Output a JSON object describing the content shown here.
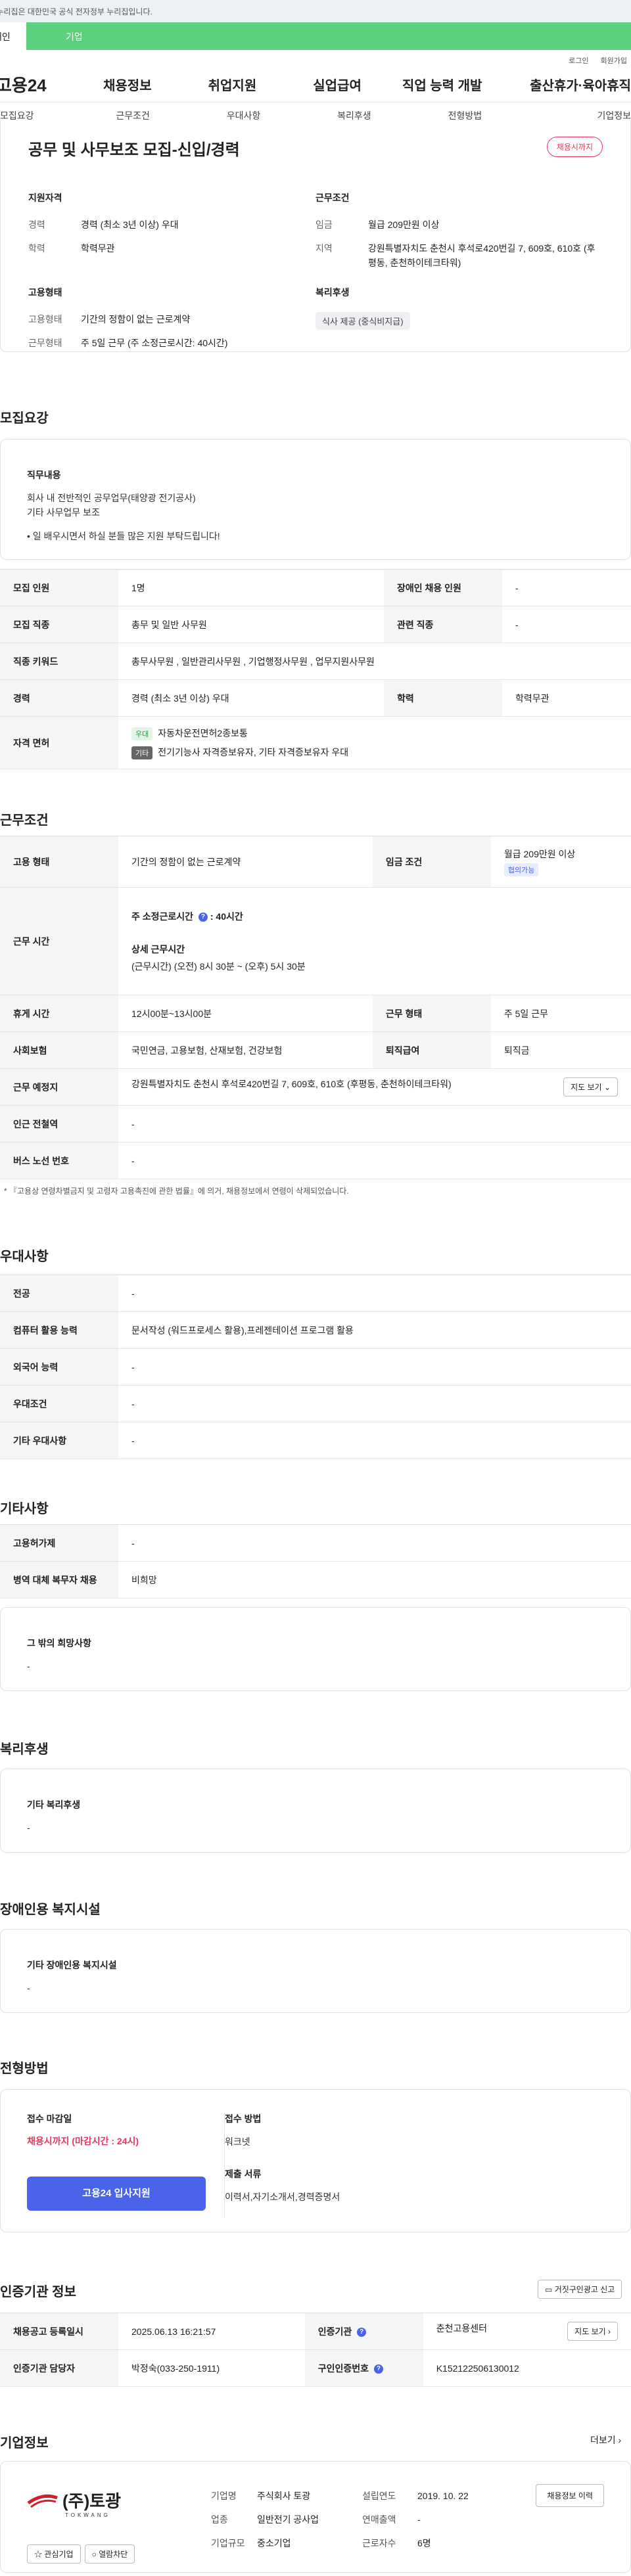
{
  "gov_banner": "이 누리집은 대한민국 공식 전자정부 누리집입니다.",
  "user_tabs": [
    "개인",
    "기업"
  ],
  "top_links": [
    "로그인",
    "회원가입"
  ],
  "logo": "고용24",
  "gnb": [
    "채용정보",
    "취업지원",
    "실업급여",
    "직업 능력 개발",
    "출산휴가·육아휴직"
  ],
  "subnav": [
    "모집요강",
    "근무조건",
    "우대사항",
    "복리후생",
    "전형방법",
    "기업정보"
  ],
  "summary": {
    "title": "공무 및 사무보조 모집-신입/경력",
    "dday": "채용시까지",
    "qual_h": "지원자격",
    "exp_k": "경력",
    "exp_v": "경력 (최소 3년 이상) 우대",
    "edu_k": "학력",
    "edu_v": "학력무관",
    "emp_h": "고용형태",
    "emp_k": "고용형태",
    "emp_v": "기간의 정함이 없는 근로계약",
    "wk_k": "근무형태",
    "wk_v": "주 5일 근무 (주 소정근로시간: 40시간)",
    "cond_h": "근무조건",
    "wage_k": "임금",
    "wage_v": "월급 209만원 이상",
    "loc_k": "지역",
    "loc_v": "강원특별자치도 춘천시 후석로420번길 7, 609호, 610호 (후평동, 춘천하이테크타워)",
    "wel_h": "복리후생",
    "wel_chip": "식사 제공 (중식비지급)"
  },
  "recruit": {
    "title": "모집요강",
    "duty_h": "직무내용",
    "duty_1": "회사 내 전반적인 공무업무(태양광 전기공사)",
    "duty_2": "기타 사무업무 보조",
    "duty_3": "• 일 배우시면서 하실 분들 많은 지원 부탁드립니다!",
    "rows": {
      "people_k": "모집 인원",
      "people_v": "1명",
      "dis_k": "장애인 채용 인원",
      "dis_v": "-",
      "job_k": "모집 직종",
      "job_v": "총무 및 일반 사무원",
      "rel_k": "관련 직종",
      "rel_v": "-",
      "kw_k": "직종 키워드",
      "kw_v": "총무사무원 , 일반관리사무원 , 기업행정사무원 , 업무지원사무원",
      "exp_k": "경력",
      "exp_v": "경력 (최소 3년 이상) 우대",
      "edu_k": "학력",
      "edu_v": "학력무관",
      "lic_k": "자격 면허",
      "lic_b1": "우대",
      "lic_v1": "자동차운전면허2종보통",
      "lic_b2": "기타",
      "lic_v2": "전기기능사 자격증보유자, 기타 자격증보유자 우대"
    }
  },
  "cond": {
    "title": "근무조건",
    "type_k": "고용 형태",
    "type_v": "기간의 정함이 없는 근로계약",
    "wage_k": "임금 조건",
    "wage_v": "월급 209만원 이상",
    "wage_b": "협의가능",
    "time_k": "근무 시간",
    "time_h1": "주 소정근로시간",
    "time_v1": "40시간",
    "time_h2": "상세 근무시간",
    "time_v2": "(근무시간) (오전) 8시 30분 ~ (오후) 5시 30분",
    "rest_k": "휴게 시간",
    "rest_v": "12시00분~13시00분",
    "form_k": "근무 형태",
    "form_v": "주 5일 근무",
    "ins_k": "사회보험",
    "ins_v": "국민연금, 고용보험, 산재보험, 건강보험",
    "ret_k": "퇴직급여",
    "ret_v": "퇴직금",
    "place_k": "근무 예정지",
    "place_v": "강원특별자치도 춘천시 후석로420번길 7, 609호, 610호 (후평동, 춘천하이테크타워)",
    "map_btn": "지도 보기",
    "sub_k": "인근 전철역",
    "sub_v": "-",
    "bus_k": "버스 노선 번호",
    "bus_v": "-",
    "note": "* 『고용상 연령차별금지 및 고령자 고용촉진에 관한 법률』에 의거, 채용정보에서 연령이 삭제되었습니다."
  },
  "pref": {
    "title": "우대사항",
    "major_k": "전공",
    "major_v": "-",
    "pc_k": "컴퓨터 활용 능력",
    "pc_v": "문서작성 (워드프로세스 활용),프레젠테이션 프로그램 활용",
    "lang_k": "외국어 능력",
    "lang_v": "-",
    "cond_k": "우대조건",
    "cond_v": "-",
    "etc_k": "기타 우대사항",
    "etc_v": "-"
  },
  "other": {
    "title": "기타사항",
    "emp_k": "고용허가제",
    "emp_v": "-",
    "mil_k": "병역 대체 복무자 채용",
    "mil_v": "비희망",
    "wish_h": "그 밖의 희망사항",
    "wish_v": "-"
  },
  "welfare": {
    "title": "복리후생",
    "h": "기타 복리후생",
    "v": "-"
  },
  "facility": {
    "title": "장애인용 복지시설",
    "h": "기타 장애인용 복지시설",
    "v": "-"
  },
  "process": {
    "title": "전형방법",
    "close_h": "접수 마감일",
    "close_v": "채용시까지 (마감시간 : 24시)",
    "apply_btn": "고용24 입사지원",
    "method_h": "접수 방법",
    "method_v": "워크넷",
    "docs_h": "제출 서류",
    "docs_v": "이력서,자기소개서,경력증명서"
  },
  "cert": {
    "title": "인증기관 정보",
    "report_btn": "거짓구인광고 신고",
    "reg_k": "채용공고 등록일시",
    "reg_v": "2025.06.13 16:21:57",
    "org_k": "인증기관",
    "org_v": "춘천고용센터",
    "dir_btn": "지도 보기",
    "mgr_k": "인증기관 담당자",
    "mgr_v": "박정숙(033-250-1911)",
    "no_k": "구인인증번호",
    "no_v": "K152122506130012"
  },
  "company": {
    "title": "기업정보",
    "more": "더보기",
    "logo_text": "(주)토광",
    "logo_sub": "TOKWANG",
    "fav_btn": "관심기업",
    "block_btn": "열람차단",
    "name_k": "기업명",
    "name_v": "주식회사 토광",
    "year_k": "설립연도",
    "year_v": "2019. 10. 22",
    "ind_k": "업종",
    "ind_v": "일반전기 공사업",
    "sales_k": "연매출액",
    "sales_v": "-",
    "size_k": "기업규모",
    "size_v": "중소기업",
    "staff_k": "근로자수",
    "staff_v": "6명",
    "hist_btn": "채용정보 이력"
  }
}
